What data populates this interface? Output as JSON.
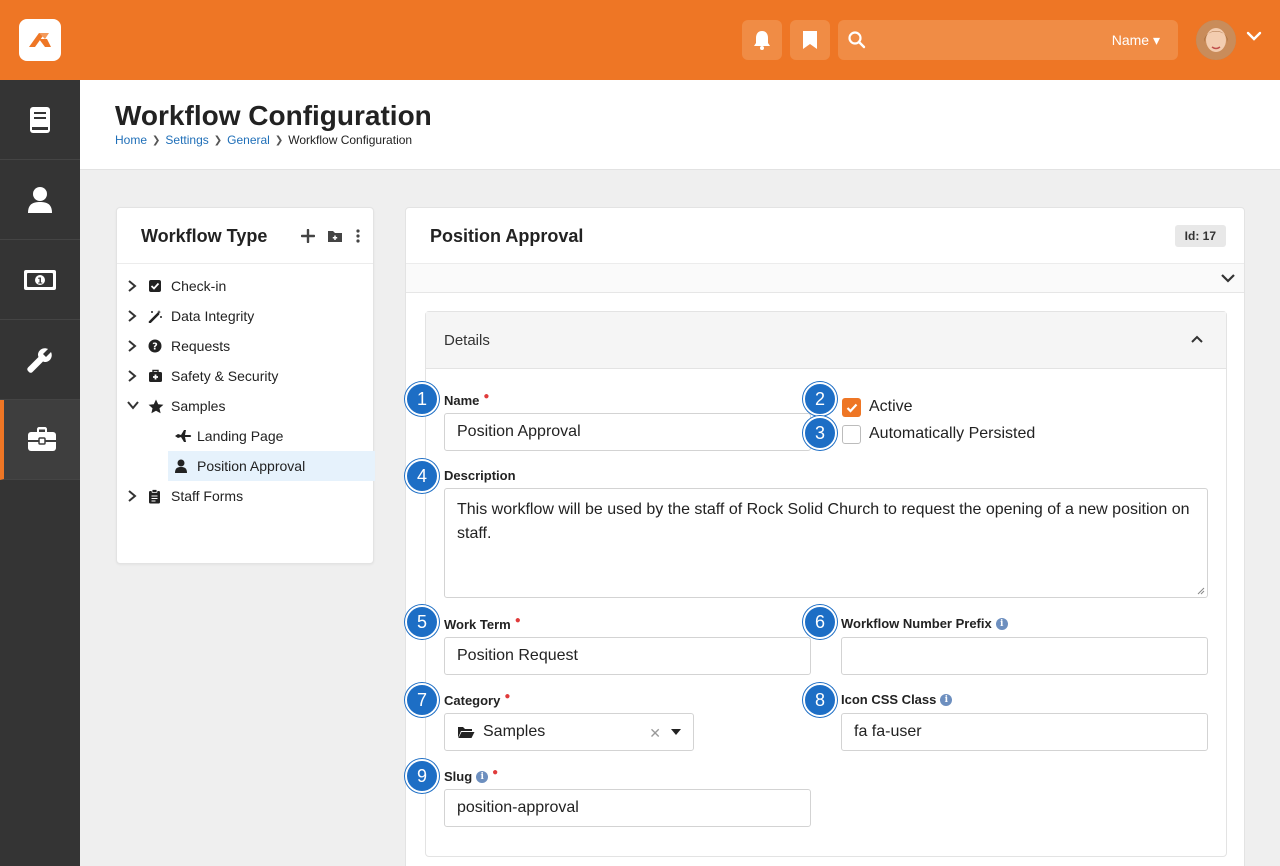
{
  "topbar": {
    "search_scope": "Name",
    "colors": {
      "brand": "#ee7625"
    }
  },
  "page": {
    "title": "Workflow Configuration",
    "breadcrumb": [
      "Home",
      "Settings",
      "General",
      "Workflow Configuration"
    ]
  },
  "tree": {
    "title": "Workflow Type",
    "items": [
      {
        "label": "Check-in",
        "icon": "check-square-icon"
      },
      {
        "label": "Data Integrity",
        "icon": "magic-wand-icon"
      },
      {
        "label": "Requests",
        "icon": "question-circle-icon"
      },
      {
        "label": "Safety & Security",
        "icon": "medkit-icon"
      },
      {
        "label": "Samples",
        "icon": "star-icon"
      },
      {
        "label": "Landing Page",
        "icon": "plane-icon"
      },
      {
        "label": "Position Approval",
        "icon": "user-icon"
      },
      {
        "label": "Staff Forms",
        "icon": "clipboard-icon"
      }
    ]
  },
  "main": {
    "title": "Position Approval",
    "id_badge": "Id: 17",
    "details_label": "Details",
    "fields": {
      "name": {
        "label": "Name",
        "value": "Position Approval"
      },
      "active": {
        "label": "Active",
        "checked": true
      },
      "persisted": {
        "label": "Automatically Persisted",
        "checked": false
      },
      "description": {
        "label": "Description",
        "value": "This workflow will be used by the staff of Rock Solid Church to request the opening of a new position on staff."
      },
      "work_term": {
        "label": "Work Term",
        "value": "Position Request"
      },
      "number_prefix": {
        "label": "Workflow Number Prefix",
        "value": ""
      },
      "category": {
        "label": "Category",
        "value": "Samples"
      },
      "icon_css": {
        "label": "Icon CSS Class",
        "value": "fa fa-user"
      },
      "slug": {
        "label": "Slug",
        "value": "position-approval"
      }
    },
    "markers": [
      "1",
      "2",
      "3",
      "4",
      "5",
      "6",
      "7",
      "8",
      "9"
    ]
  }
}
